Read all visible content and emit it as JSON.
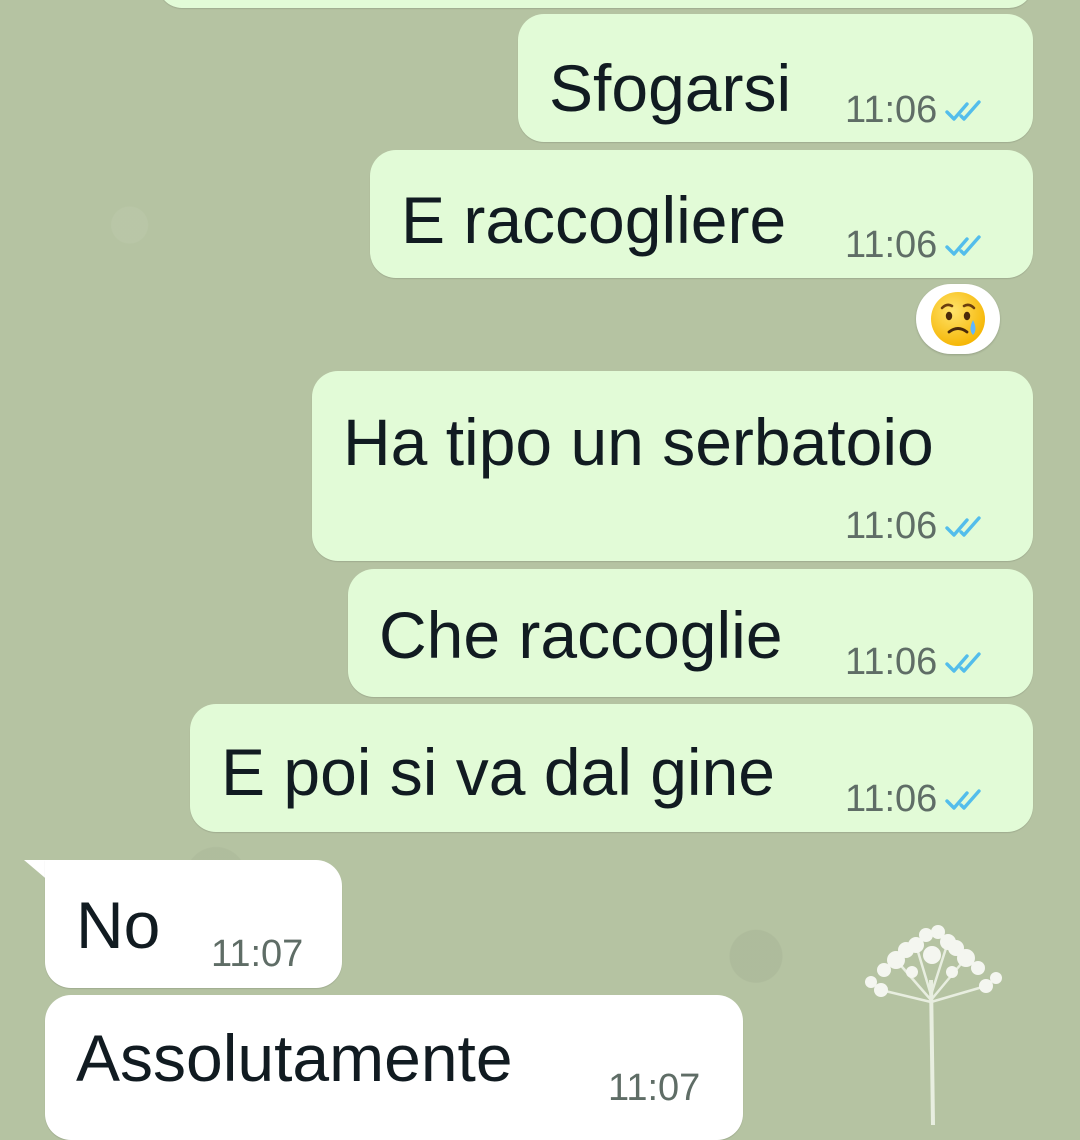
{
  "messages": [
    {
      "text": "Sfogarsi",
      "time": "11:06",
      "direction": "outgoing",
      "status": "read"
    },
    {
      "text": "E raccogliere",
      "time": "11:06",
      "direction": "outgoing",
      "status": "read"
    },
    {
      "text": "Ha tipo un serbatoio",
      "time": "11:06",
      "direction": "outgoing",
      "status": "read"
    },
    {
      "text": "Che raccoglie",
      "time": "11:06",
      "direction": "outgoing",
      "status": "read"
    },
    {
      "text": "E poi si va dal gine",
      "time": "11:06",
      "direction": "outgoing",
      "status": "read"
    },
    {
      "text": "No",
      "time": "11:07",
      "direction": "incoming"
    },
    {
      "text": "Assolutamente",
      "time": "11:07",
      "direction": "incoming"
    }
  ],
  "reaction": {
    "emoji": "😥",
    "icon": "sad-but-relieved-face-emoji"
  },
  "colors": {
    "wallpaper": "#b5c3a2",
    "outgoing_bubble": "#e2fbd7",
    "incoming_bubble": "#ffffff",
    "read_ticks": "#53bdeb",
    "timestamp": "#5f6d66"
  }
}
